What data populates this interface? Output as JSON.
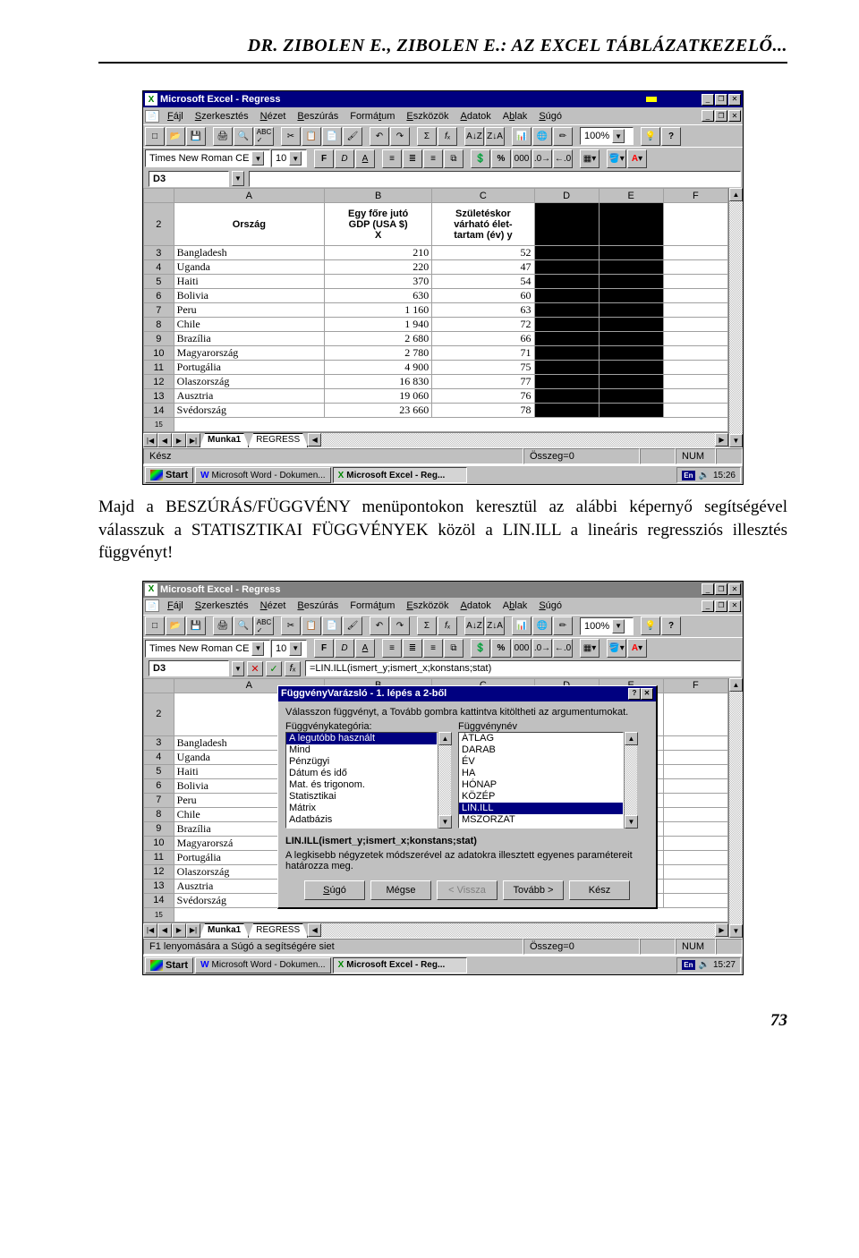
{
  "page": {
    "header": "DR. ZIBOLEN E., ZIBOLEN E.: AZ EXCEL TÁBLÁZATKEZELŐ...",
    "paragraph": "Majd a BESZÚRÁS/FÜGGVÉNY menüpontokon keresztül az alábbi képernyő segítségével válasszuk a STATISZTIKAI FÜGGVÉNYEK közöl a LIN.ILL a lineáris regressziós illesztés függvényt!",
    "pagenum": "73"
  },
  "chart_data": {
    "type": "table",
    "columns": [
      "Ország",
      "Egy főre jutó GDP (USA $) X",
      "Születéskor várható élettartam (év) y"
    ],
    "rows": [
      [
        "Bangladesh",
        210,
        52
      ],
      [
        "Uganda",
        220,
        47
      ],
      [
        "Haiti",
        370,
        54
      ],
      [
        "Bolivia",
        630,
        60
      ],
      [
        "Peru",
        "1 160",
        63
      ],
      [
        "Chile",
        "1 940",
        72
      ],
      [
        "Brazília",
        "2 680",
        66
      ],
      [
        "Magyarország",
        "2 780",
        71
      ],
      [
        "Portugália",
        "4 900",
        75
      ],
      [
        "Olaszország",
        "16 830",
        77
      ],
      [
        "Ausztria",
        "19 060",
        76
      ],
      [
        "Svédország",
        "23 660",
        78
      ]
    ]
  },
  "shot1": {
    "title": "Microsoft Excel - Regress",
    "menus": [
      "Fájl",
      "Szerkesztés",
      "Nézet",
      "Beszúrás",
      "Formátum",
      "Eszközök",
      "Adatok",
      "Ablak",
      "Súgó"
    ],
    "font": "Times New Roman CE",
    "fontsize": "10",
    "zoom": "100%",
    "namebox": "D3",
    "cols": [
      "A",
      "B",
      "C",
      "D",
      "E",
      "F"
    ],
    "row_start": 2,
    "h1": "Ország",
    "h2a": "Egy főre jutó",
    "h2b": "GDP (USA $)",
    "h2c": "X",
    "h3a": "Születéskor",
    "h3b": "várható élet-",
    "h3c": "tartam (év) y",
    "tabs": [
      "Munka1",
      "REGRESS"
    ],
    "status_left": "Kész",
    "status_sum": "Összeg=0",
    "status_num": "NUM",
    "task_word": "Microsoft Word - Dokumen...",
    "task_excel": "Microsoft Excel - Reg...",
    "start": "Start",
    "lang": "En",
    "clock": "15:26"
  },
  "shot2": {
    "title": "Microsoft Excel - Regress",
    "menus": [
      "Fájl",
      "Szerkesztés",
      "Nézet",
      "Beszúrás",
      "Formátum",
      "Eszközök",
      "Adatok",
      "Ablak",
      "Súgó"
    ],
    "font": "Times New Roman CE",
    "fontsize": "10",
    "zoom": "100%",
    "namebox": "D3",
    "formula": "=LIN.ILL(ismert_y;ismert_x;konstans;stat)",
    "cols": [
      "A",
      "B",
      "C",
      "D",
      "E",
      "F"
    ],
    "countries": [
      "Bangladesh",
      "Uganda",
      "Haiti",
      "Bolivia",
      "Peru",
      "Chile",
      "Brazília",
      "Magyarorszá",
      "Portugália",
      "Olaszország",
      "Ausztria",
      "Svédország"
    ],
    "dialog": {
      "title": "FüggvényVarázsló - 1. lépés a 2-ből",
      "intro": "Válasszon függvényt, a Tovább gombra kattintva kitöltheti az argumentumokat.",
      "cat_label": "Függvénykategória:",
      "name_label": "Függvénynév",
      "categories": [
        "A legutóbb használt",
        "Mind",
        "Pénzügyi",
        "Dátum és idő",
        "Mat. és trigonom.",
        "Statisztikai",
        "Mátrix",
        "Adatbázis"
      ],
      "names": [
        "ÁTLAG",
        "DARAB",
        "ÉV",
        "HA",
        "HÓNAP",
        "KÖZÉP",
        "LIN.ILL",
        "MSZORZAT"
      ],
      "signature": "LIN.ILL(ismert_y;ismert_x;konstans;stat)",
      "desc": "A legkisebb négyzetek módszerével az adatokra illesztett egyenes paramétereit határozza meg.",
      "btns": {
        "help": "Súgó",
        "cancel": "Mégse",
        "back": "< Vissza",
        "next": "Tovább >",
        "finish": "Kész"
      }
    },
    "tabs": [
      "Munka1",
      "REGRESS"
    ],
    "status_left": "F1 lenyomására a Súgó a segítségére siet",
    "status_sum": "Összeg=0",
    "status_num": "NUM",
    "task_word": "Microsoft Word - Dokumen...",
    "task_excel": "Microsoft Excel - Reg...",
    "start": "Start",
    "lang": "En",
    "clock": "15:27"
  }
}
